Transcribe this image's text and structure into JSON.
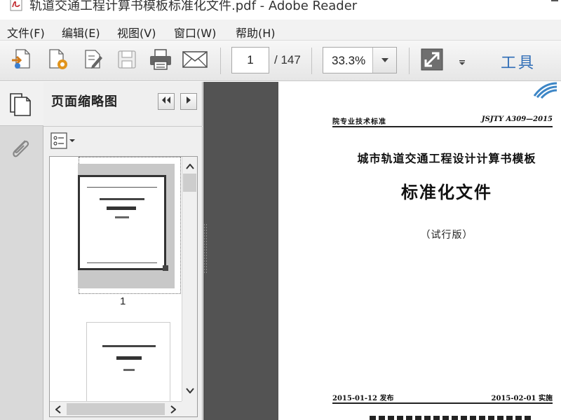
{
  "window": {
    "title": "轨道交通工程计算书模板标准化文件.pdf - Adobe Reader"
  },
  "menu": {
    "items": [
      "文件(F)",
      "编辑(E)",
      "视图(V)",
      "窗口(W)",
      "帮助(H)"
    ]
  },
  "toolbar": {
    "page_number": "1",
    "page_total": "/ 147",
    "zoom": "33.3%",
    "tools_label": "工具"
  },
  "panel": {
    "title": "页面缩略图",
    "thumbnail_page_label": "1"
  },
  "document": {
    "header_left": "院专业技术标准",
    "header_right": "JSJTY A309—2015",
    "title_line1": "城市轨道交通工程设计计算书模板",
    "title_line2": "标准化文件",
    "subtitle": "（试行版）",
    "footer_left": "2015-01-12 发布",
    "footer_right": "2015-02-01 实施"
  },
  "colors": {
    "accent": "#2f6db6",
    "doc_background": "#535353",
    "panel_background": "#efefef",
    "nav_background": "#d9d9d9"
  },
  "icons": [
    "pdf-file-icon",
    "create-pdf-icon",
    "export-icon",
    "sign-icon",
    "save-icon",
    "print-icon",
    "email-icon",
    "fit-page-icon",
    "pages-icon",
    "attachment-icon",
    "thumbnail-options-icon"
  ]
}
